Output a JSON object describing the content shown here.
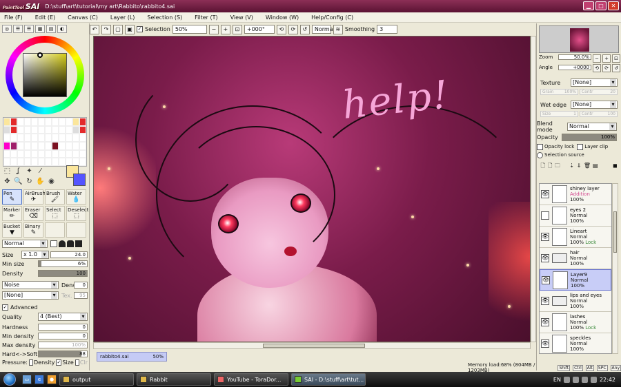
{
  "window": {
    "app_logo": "SAI",
    "app_logo_prefix": "PaintTool",
    "title_path": "D:\\stuff\\art\\tutorial\\my art\\Rabbito\\rabbito4.sai",
    "min": "▁",
    "max": "□",
    "close": "✕"
  },
  "menu": [
    "File (F)",
    "Edit (E)",
    "Canvas (C)",
    "Layer (L)",
    "Selection (S)",
    "Filter (T)",
    "View (V)",
    "Window (W)",
    "Help/Config (C)"
  ],
  "toolbar": {
    "selection_label": "Selection",
    "selection_checked": "✓",
    "zoom": "50%",
    "rotation": "+000°",
    "mode": "Normal",
    "smoothing_label": "Smoothing",
    "smoothing_value": "3"
  },
  "colors": {
    "foreground": "#fbe69c",
    "background": "#5555ff"
  },
  "brushes": [
    {
      "label": "Pen",
      "icon": "✎"
    },
    {
      "label": "AirBrush",
      "icon": "✈"
    },
    {
      "label": "Brush",
      "icon": "🖌"
    },
    {
      "label": "Water",
      "icon": "💧"
    },
    {
      "label": "Marker",
      "icon": "✏"
    },
    {
      "label": "Eraser",
      "icon": "⌫"
    },
    {
      "label": "Select",
      "icon": "⬚"
    },
    {
      "label": "Deselect",
      "icon": "⬚"
    },
    {
      "label": "Bucket",
      "icon": "▼"
    },
    {
      "label": "Binary",
      "icon": "✎"
    },
    {
      "label": "",
      "icon": ""
    },
    {
      "label": "",
      "icon": ""
    }
  ],
  "tool_props": {
    "blend": "Normal",
    "size_label": "Size",
    "size_mult": "x 1.0",
    "size_value": "24.0",
    "min_size_label": "Min size",
    "min_size_value": "6%",
    "density_label": "Density",
    "density_value": "100",
    "texture": "Noise",
    "dens_label": "Dens",
    "dens_value": "0",
    "texture2": "[None]",
    "tex_label": "Tex.",
    "tex_value": "95",
    "advanced_label": "Advanced",
    "quality_label": "Quality",
    "quality_value": "4 (Best)",
    "hardness_label": "Hardness",
    "hardness_value": "0",
    "min_density_label": "Min density",
    "min_density_value": "0",
    "max_density_label": "Max density",
    "max_density_value": "100%",
    "hard_soft_label": "Hard<->Soft",
    "hard_soft_value": "88",
    "pressure_label": "Pressure:",
    "pressure_density": "Density",
    "pressure_size": "Size",
    "pressure_clr": "Clr"
  },
  "canvas": {
    "text": "help!"
  },
  "doc_tab": {
    "name": "rabbito4.sai",
    "zoom": "50%"
  },
  "navigator": {
    "zoom_label": "Zoom",
    "zoom_value": "50.0%",
    "angle_label": "Angle",
    "angle_value": "+0000"
  },
  "layer_props": {
    "texture_label": "Texture",
    "texture_value": "[None]",
    "grain_label": "Grain",
    "grain_value": "100%",
    "contrast_label": "Contr",
    "contrast_value": "20",
    "wet_edge_label": "Wet edge",
    "wet_edge_value": "[None]",
    "size_label": "Size",
    "size_value": "1",
    "strength_label": "Contr",
    "strength_value": "100",
    "blend_label": "Blend mode",
    "blend_value": "Normal",
    "opacity_label": "Opacity",
    "opacity_value": "100%",
    "opacity_lock": "Opacity lock",
    "layer_clip": "Layer clip",
    "selection_source": "Selection source"
  },
  "layers": [
    {
      "name": "shiney layer",
      "mode": "Addition",
      "opacity": "100%",
      "lock": "",
      "visible": true,
      "folder": false,
      "selected": false
    },
    {
      "name": "eyes 2",
      "mode": "Normal",
      "opacity": "100%",
      "lock": "",
      "visible": false,
      "folder": false,
      "selected": false
    },
    {
      "name": "Lineart",
      "mode": "Normal",
      "opacity": "100%",
      "lock": "Lock",
      "visible": true,
      "folder": false,
      "selected": false
    },
    {
      "name": "hair",
      "mode": "Normal",
      "opacity": "100%",
      "lock": "",
      "visible": true,
      "folder": true,
      "selected": false
    },
    {
      "name": "Layer9",
      "mode": "Normal",
      "opacity": "100%",
      "lock": "",
      "visible": true,
      "folder": false,
      "selected": true
    },
    {
      "name": "lips and eyes",
      "mode": "Normal",
      "opacity": "100%",
      "lock": "",
      "visible": true,
      "folder": true,
      "selected": false
    },
    {
      "name": "lashes",
      "mode": "Normal",
      "opacity": "100%",
      "lock": "Lock",
      "visible": true,
      "folder": false,
      "selected": false
    },
    {
      "name": "speckles",
      "mode": "Normal",
      "opacity": "100%",
      "lock": "",
      "visible": true,
      "folder": false,
      "selected": false
    }
  ],
  "status": {
    "memory": "Memory load:68% (804MB / 1203MB)",
    "keys": [
      "Shift",
      "Ctrl",
      "Alt",
      "SPC",
      "Any"
    ]
  },
  "taskbar": {
    "tasks": [
      "output",
      "Rabbit",
      "YouTube - ToraDor...",
      "SAI - D:\\stuff\\art\\tut..."
    ],
    "lang": "EN",
    "time": "22:42"
  }
}
